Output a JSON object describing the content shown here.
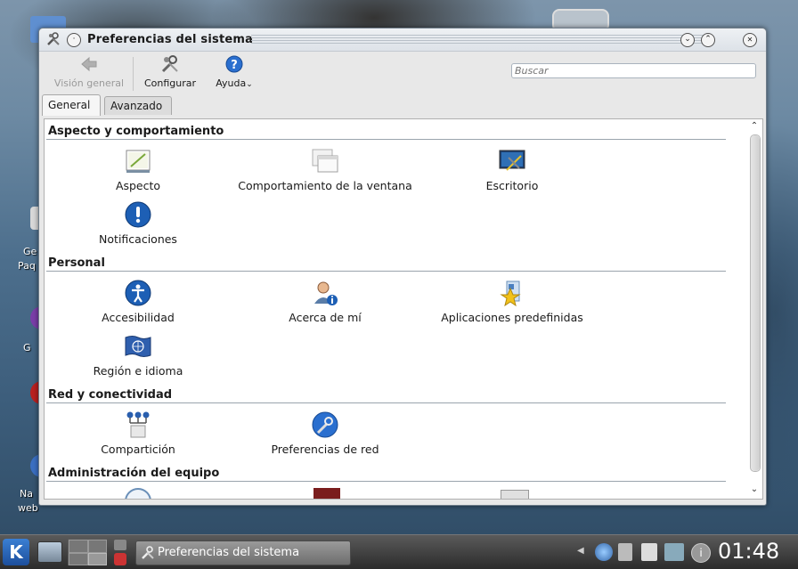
{
  "window": {
    "title": "Preferencias del sistema",
    "buttons": {
      "minimize": "⌄",
      "maximize": "⌃",
      "close": "✕"
    }
  },
  "toolbar": {
    "back_label": "Visión general",
    "configure_label": "Configurar",
    "help_label": "Ayuda",
    "search_placeholder": "Buscar"
  },
  "tabs": [
    {
      "label": "General",
      "active": true
    },
    {
      "label": "Avanzado",
      "active": false
    }
  ],
  "sections": [
    {
      "title": "Aspecto y comportamiento",
      "items": [
        {
          "label": "Aspecto",
          "icon": "palette-icon"
        },
        {
          "label": "Comportamiento de la ventana",
          "icon": "windows-icon"
        },
        {
          "label": "Escritorio",
          "icon": "desktop-icon"
        },
        {
          "label": "Notificaciones",
          "icon": "exclamation-icon"
        }
      ]
    },
    {
      "title": "Personal",
      "items": [
        {
          "label": "Accesibilidad",
          "icon": "accessibility-icon"
        },
        {
          "label": "Acerca de mí",
          "icon": "user-info-icon"
        },
        {
          "label": "Aplicaciones predefinidas",
          "icon": "default-apps-icon"
        },
        {
          "label": "Región e idioma",
          "icon": "flag-icon"
        }
      ]
    },
    {
      "title": "Red y conectividad",
      "items": [
        {
          "label": "Compartición",
          "icon": "sharing-icon"
        },
        {
          "label": "Preferencias de red",
          "icon": "network-prefs-icon"
        }
      ]
    },
    {
      "title": "Administración del equipo",
      "items": []
    }
  ],
  "taskbar": {
    "task_label": "Preferencias del sistema",
    "clock": "01:48"
  },
  "colors": {
    "titlebar": "#e2e6eb",
    "accent_blue": "#1d5fb5",
    "taskbar": "#3c3c3c"
  }
}
